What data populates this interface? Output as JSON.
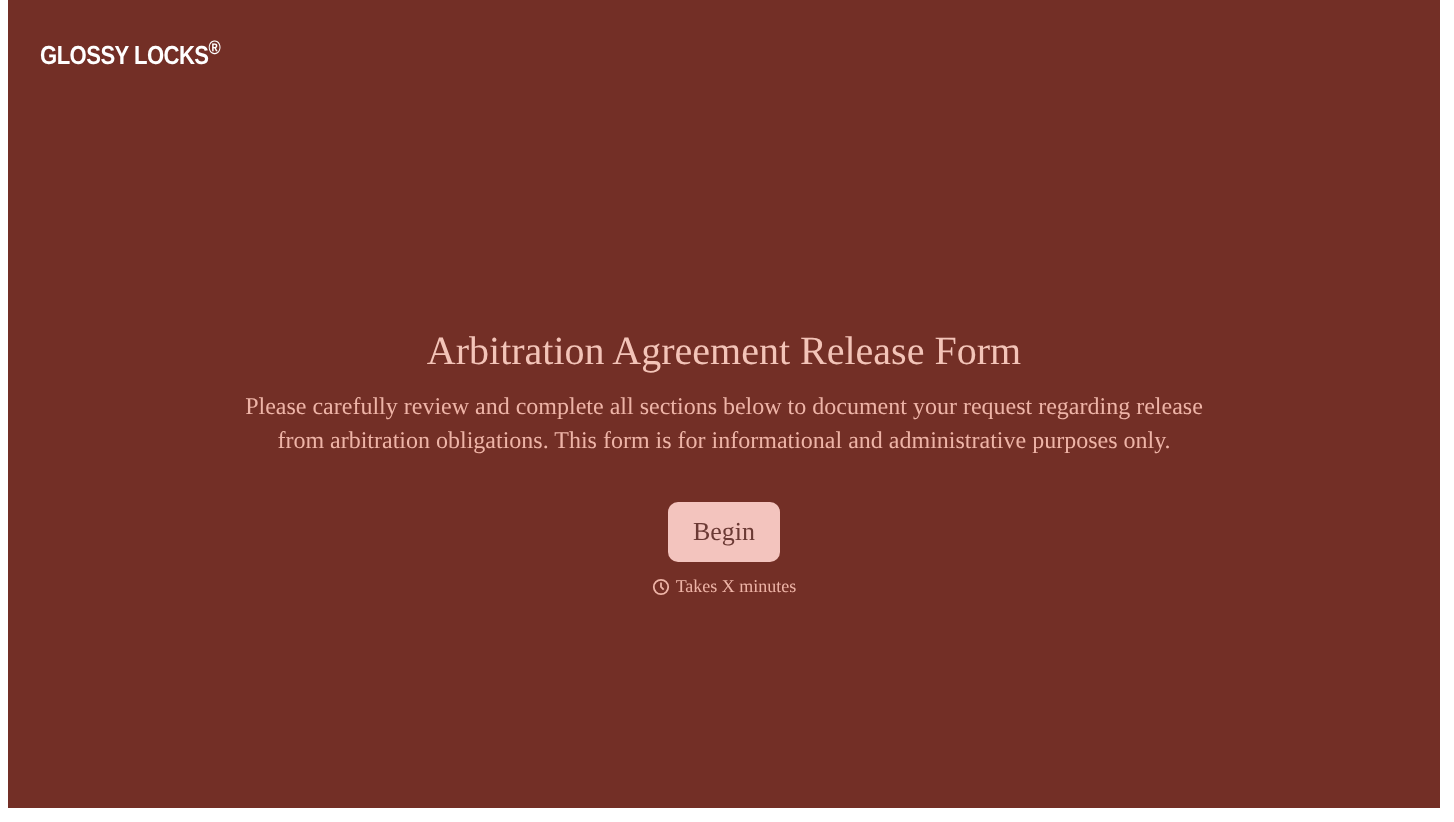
{
  "brand": {
    "name": "GLOSSY LOCKS$^{®}$"
  },
  "intro": {
    "title": "Arbitration Agreement Release Form",
    "description": "Please carefully review and complete all sections below to document your request regarding release from arbitration obligations. This form is for informational and administrative purposes only.",
    "button": "Begin",
    "duration": "Takes X minutes"
  }
}
